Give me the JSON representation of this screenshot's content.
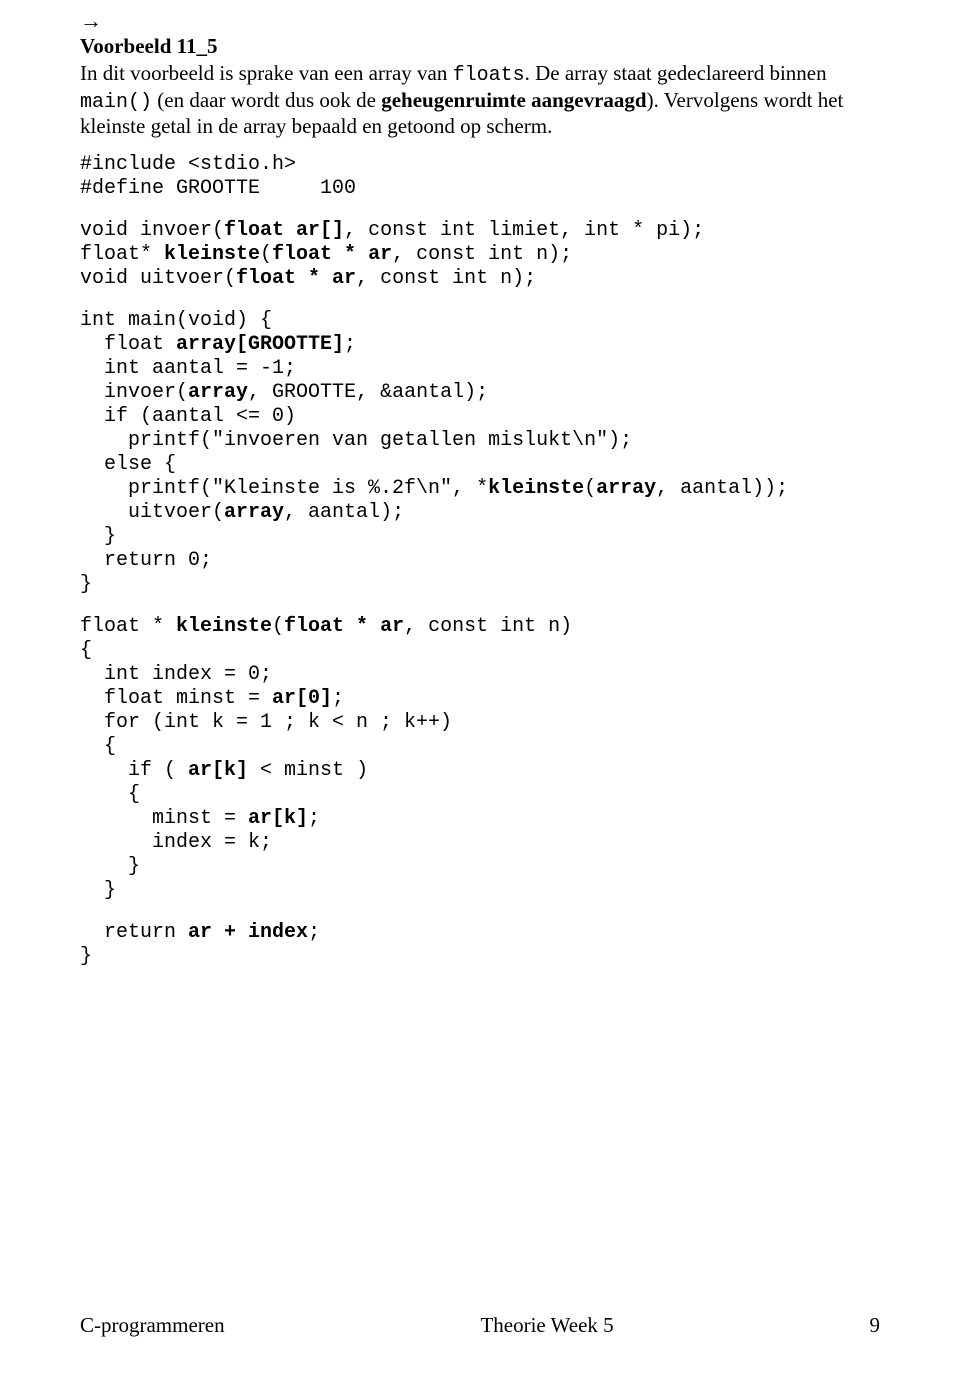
{
  "arrow": "→",
  "heading": "Voorbeeld 11_5",
  "para": {
    "t1": "In dit voorbeeld is sprake van een array van ",
    "c1": "floats",
    "t2": ". De array staat gedeclareerd binnen ",
    "c2": "main()",
    "t3": " (en daar wordt dus ook de ",
    "b1": "geheugenruimte aangevraagd",
    "t4": "). Vervolgens wordt het kleinste getal in de array bepaald en getoond op scherm."
  },
  "code1": {
    "l1": "#include <stdio.h>",
    "l2a": "#define GROOTTE",
    "l2b": "     100",
    "l3a": "void invoer(",
    "l3b": "float ar[]",
    "l3c": ", const int limiet, int * pi);",
    "l4a": "float* ",
    "l4b": "kleinste",
    "l4c": "(",
    "l4d": "float * ar",
    "l4e": ", const int n);",
    "l5a": "void uitvoer(",
    "l5b": "float * ar",
    "l5c": ", const int n);"
  },
  "code2": {
    "l1": "int main(void) {",
    "l2a": "  float ",
    "l2b": "array[GROOTTE]",
    "l2c": ";",
    "l3": "  int aantal = -1;",
    "l4a": "  invoer(",
    "l4b": "array",
    "l4c": ", GROOTTE, &aantal);",
    "l5": "  if (aantal <= 0)",
    "l6": "    printf(\"invoeren van getallen mislukt\\n\");",
    "l7": "  else {",
    "l8a": "    printf(\"Kleinste is %.2f\\n\", *",
    "l8b": "kleinste",
    "l8c": "(",
    "l8d": "array",
    "l8e": ", aantal));",
    "l9a": "    uitvoer(",
    "l9b": "array",
    "l9c": ", aantal);",
    "l10": "  }",
    "l11": "  return 0;",
    "l12": "}"
  },
  "code3": {
    "l1a": "float * ",
    "l1b": "kleinste",
    "l1c": "(",
    "l1d": "float * ar",
    "l1e": ", const int n)",
    "l2": "{",
    "l3": "  int index = 0;",
    "l4a": "  float minst = ",
    "l4b": "ar[0]",
    "l4c": ";",
    "l5": "  for (int k = 1 ; k < n ; k++)",
    "l6": "  {",
    "l7a": "    if ( ",
    "l7b": "ar[k]",
    "l7c": " < minst )",
    "l8": "    {",
    "l9a": "      minst = ",
    "l9b": "ar[k]",
    "l9c": ";",
    "l10": "      index = k;",
    "l11": "    }",
    "l12": "  }",
    "l13a": "  return ",
    "l13b": "ar + index",
    "l13c": ";",
    "l14": "}"
  },
  "footer": {
    "left": "C-programmeren",
    "center": "Theorie Week 5",
    "right": "9"
  }
}
